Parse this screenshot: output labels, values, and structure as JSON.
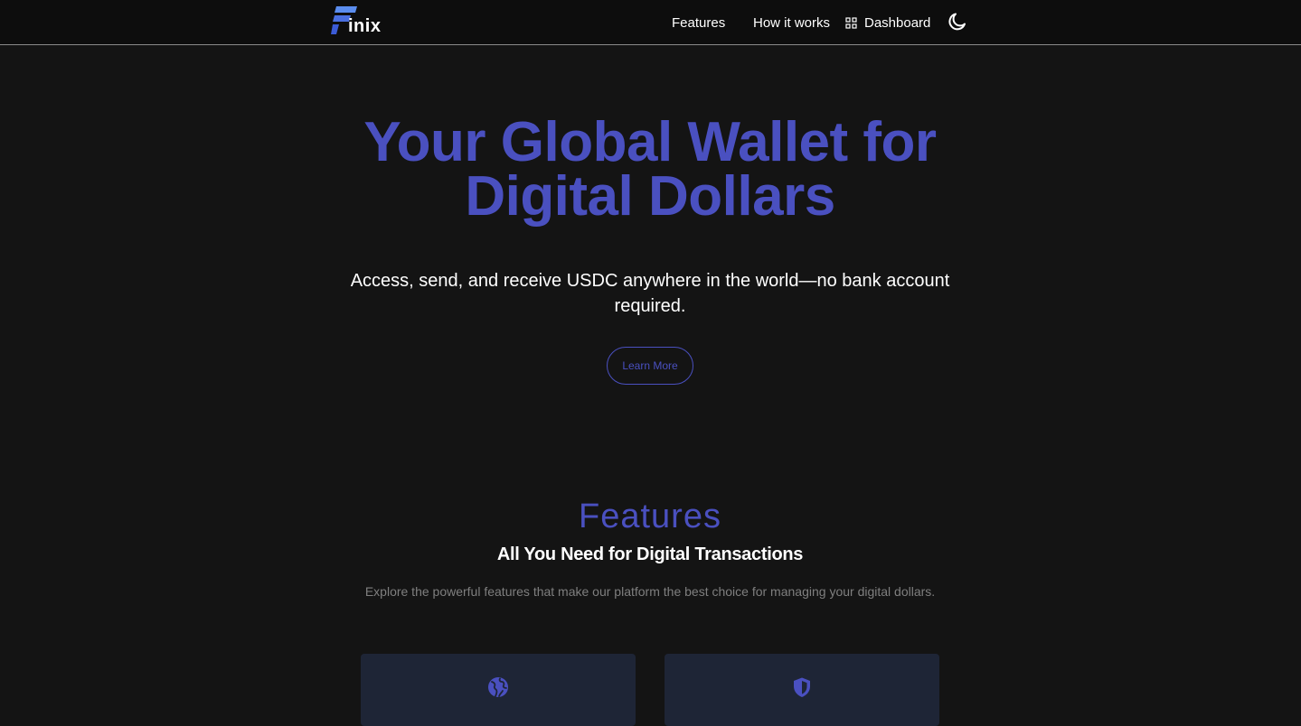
{
  "brand": {
    "logo_text": "inix",
    "accent_color": "#4a50c0",
    "logo_colors": [
      "#5b8def",
      "#3b5bd6"
    ]
  },
  "nav": {
    "items": [
      {
        "label": "Features"
      },
      {
        "label": "How it works"
      },
      {
        "label": "Dashboard",
        "icon": "grid-icon"
      }
    ],
    "theme_toggle_icon": "moon-icon"
  },
  "hero": {
    "title": "Your Global Wallet for Digital Dollars",
    "subtitle": "Access, send, and receive USDC anywhere in the world—no bank account required.",
    "cta_label": "Learn More"
  },
  "features": {
    "heading": "Features",
    "subheading": "All You Need for Digital Transactions",
    "description": "Explore the powerful features that make our platform the best choice for managing your digital dollars.",
    "cards": [
      {
        "icon": "globe-icon"
      },
      {
        "icon": "shield-icon"
      }
    ]
  }
}
